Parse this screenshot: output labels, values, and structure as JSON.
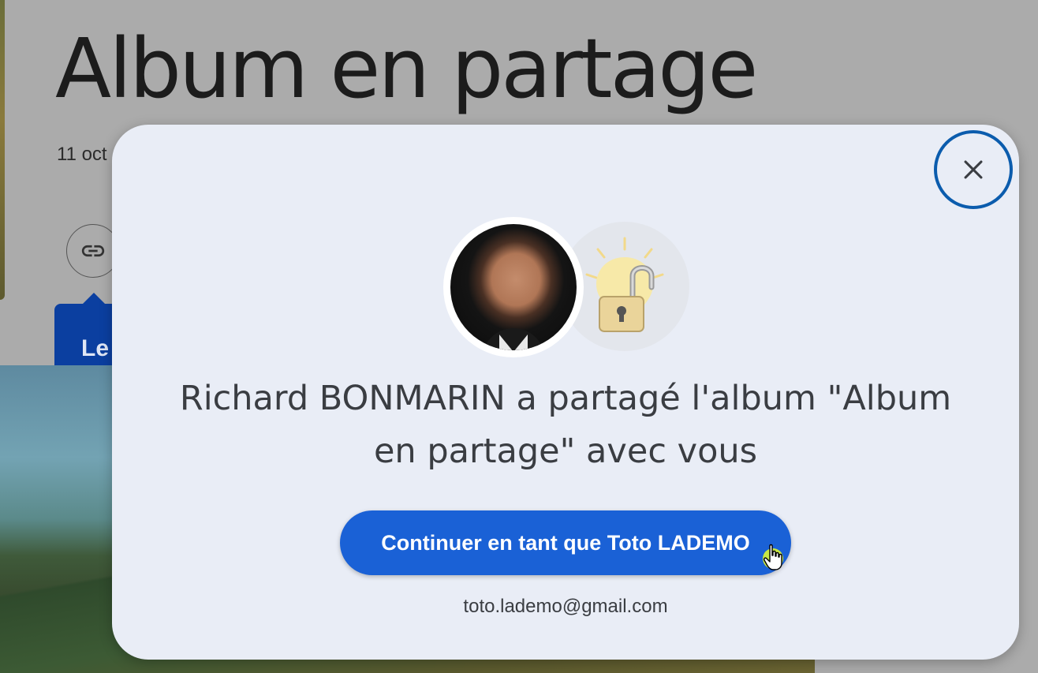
{
  "background_page": {
    "album_title": "Album en partage",
    "date_text": "11 oct",
    "tooltip_text": "Le"
  },
  "dialog": {
    "close_label": "×",
    "message": "Richard BONMARIN a partagé l'album \"Album en partage\" avec vous",
    "continue_button": "Continuer en tant que Toto LADEMO",
    "account_email": "toto.lademo@gmail.com"
  },
  "colors": {
    "primary_button": "#1a61d6",
    "dialog_background": "#e9edf6",
    "close_ring": "#0b5cad",
    "scrim": "#ababab"
  },
  "icons": [
    "link-icon",
    "close-icon",
    "lock-lightbulb-icon",
    "hand-pointer-cursor-icon"
  ]
}
